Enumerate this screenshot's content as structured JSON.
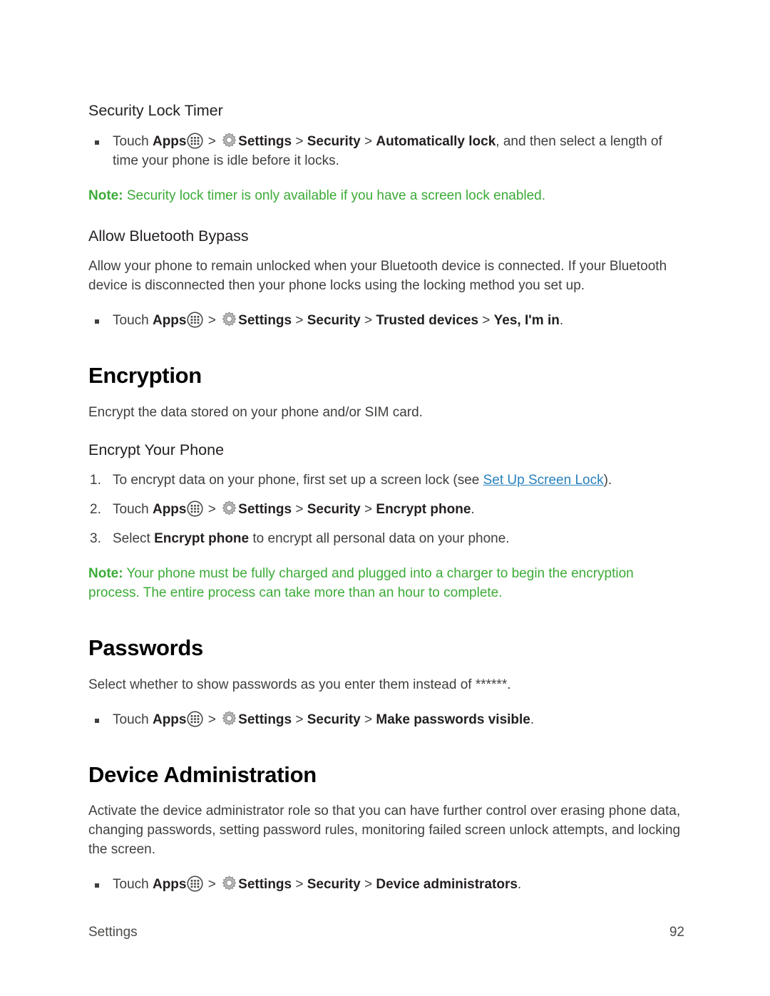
{
  "page": {
    "footer_section": "Settings",
    "footer_page_number": "92"
  },
  "icons": {
    "apps": "apps-grid-icon",
    "gear": "settings-gear-icon"
  },
  "sections": {
    "security_lock_timer": {
      "heading": "Security Lock Timer",
      "bullet": {
        "touch": "Touch ",
        "apps": "Apps",
        "gt1": " > ",
        "settings": "Settings",
        "gt2": " > ",
        "security": "Security",
        "gt3": " > ",
        "target": "Automatically lock",
        "tail": ", and then select a length of time your phone is idle before it locks."
      },
      "note": {
        "label": "Note:",
        "text": " Security lock timer is only available if you have a screen lock enabled."
      }
    },
    "allow_bluetooth_bypass": {
      "heading": "Allow Bluetooth Bypass",
      "paragraph": "Allow your phone to remain unlocked when your Bluetooth device is connected. If your Bluetooth device is disconnected then your phone locks using the locking method you set up.",
      "bullet": {
        "touch": "Touch ",
        "apps": "Apps",
        "gt1": " > ",
        "settings": "Settings",
        "gt2": " > ",
        "security": "Security",
        "gt3": " > ",
        "target": "Trusted devices",
        "gt4": " > ",
        "target2": "Yes, I'm in",
        "tail": "."
      }
    },
    "encryption": {
      "heading": "Encryption",
      "paragraph": "Encrypt the data stored on your phone and/or SIM card.",
      "sub_heading": "Encrypt Your Phone",
      "steps": {
        "step1": {
          "number": "1.",
          "pre": "To encrypt data on your phone, first set up a screen lock (see ",
          "link": "Set Up Screen Lock",
          "post": ")."
        },
        "step2": {
          "number": "2.",
          "touch": "Touch ",
          "apps": "Apps",
          "gt1": " > ",
          "settings": "Settings",
          "gt2": " > ",
          "security": "Security",
          "gt3": " > ",
          "target": "Encrypt phone",
          "tail": "."
        },
        "step3": {
          "number": "3.",
          "pre": "Select ",
          "target": "Encrypt phone",
          "post": " to encrypt all personal data on your phone."
        }
      },
      "note": {
        "label": "Note:",
        "text": " Your phone must be fully charged and plugged into a charger to begin the encryption process. The entire process can take more than an hour to complete."
      }
    },
    "passwords": {
      "heading": "Passwords",
      "paragraph": "Select whether to show passwords as you enter them instead of ******.",
      "bullet": {
        "touch": "Touch ",
        "apps": "Apps",
        "gt1": " > ",
        "settings": "Settings",
        "gt2": " > ",
        "security": "Security",
        "gt3": " > ",
        "target": "Make passwords visible",
        "tail": "."
      }
    },
    "device_administration": {
      "heading": "Device Administration",
      "paragraph": "Activate the device administrator role so that you can have further control over erasing phone data, changing passwords, setting password rules, monitoring failed screen unlock attempts, and locking the screen.",
      "bullet": {
        "touch": "Touch ",
        "apps": "Apps",
        "gt1": " > ",
        "settings": "Settings",
        "gt2": " > ",
        "security": "Security",
        "gt3": " > ",
        "target": "Device administrators",
        "tail": "."
      }
    }
  },
  "colors": {
    "note_green": "#3cab38",
    "link_blue": "#2981bd",
    "heading_black": "#000000",
    "body_gray": "#3f3f3d"
  }
}
